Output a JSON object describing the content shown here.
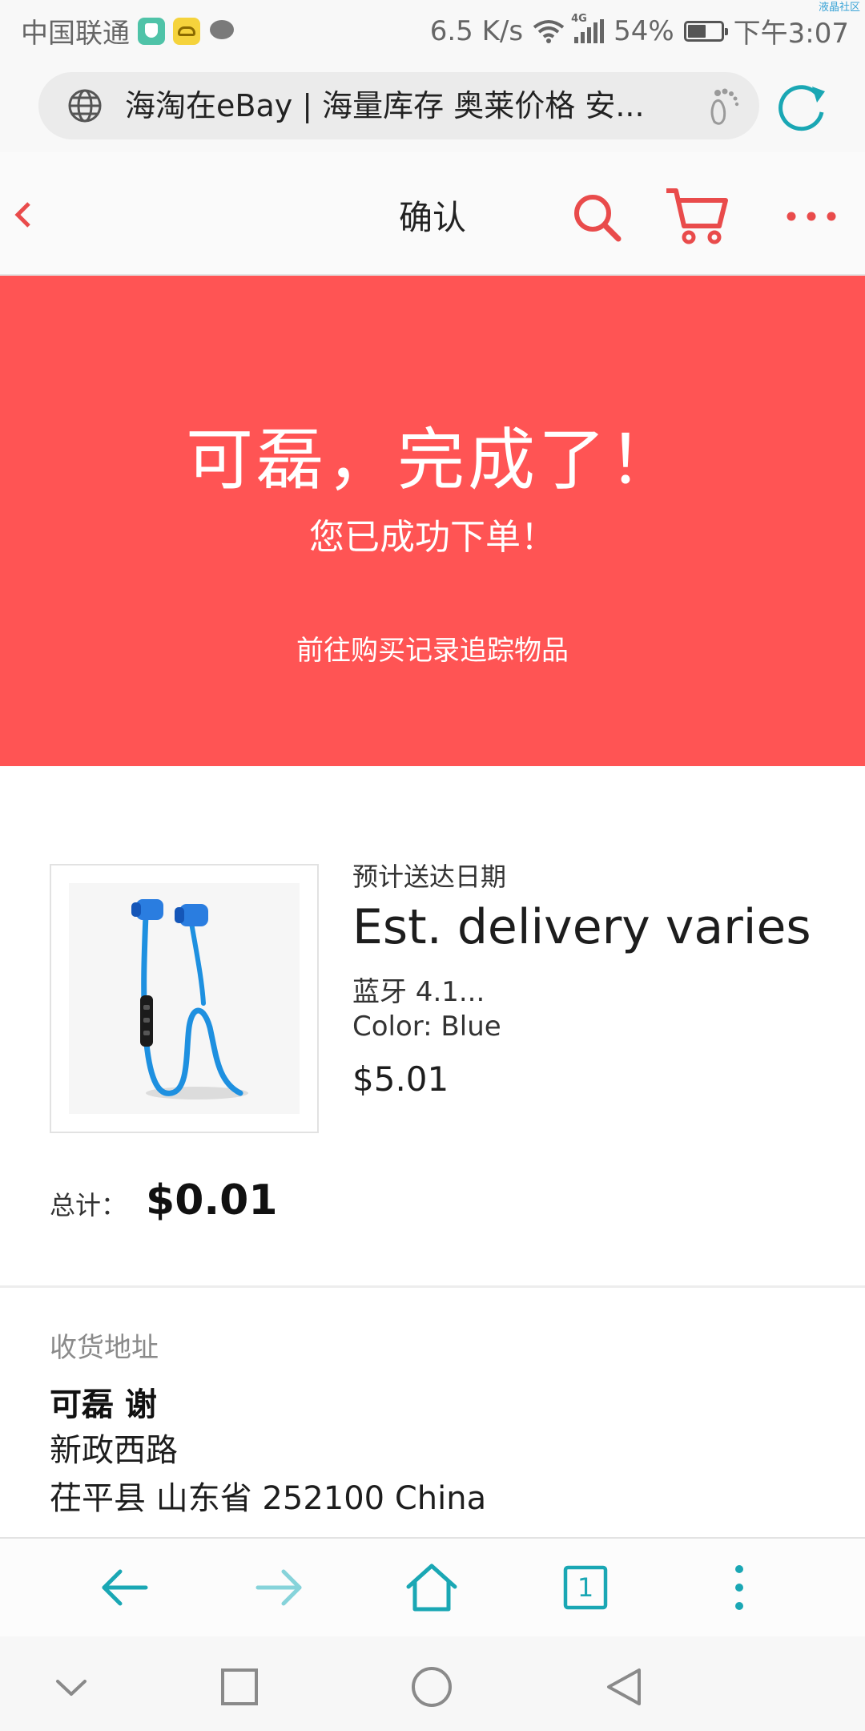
{
  "status_bar": {
    "carrier": "中国联通",
    "network_speed": "6.5 K/s",
    "network_type": "4G",
    "battery_percent": "54%",
    "battery_level": 0.54,
    "time": "下午3:07",
    "watermark": "液晶社区"
  },
  "browser": {
    "url_title": "海淘在eBay | 海量库存 奥莱价格 安...",
    "icons": [
      "globe-icon",
      "footprint-icon",
      "reload-icon"
    ],
    "accent": "#1aa7b4"
  },
  "header": {
    "title": "确认",
    "icons": [
      "back-icon",
      "search-icon",
      "cart-icon",
      "more-icon"
    ],
    "icon_color": "#e94b4b"
  },
  "banner": {
    "title": "可磊，完成了！",
    "subtitle": "您已成功下单！",
    "link": "前往购买记录追踪物品",
    "background": "#ff5454"
  },
  "order": {
    "delivery_label": "预计送达日期",
    "delivery_value": "Est. delivery varies",
    "item_name": "蓝牙 4.1...",
    "item_color": "Color: Blue",
    "item_price": "$5.01",
    "total_label": "总计：",
    "total_value": "$0.01"
  },
  "address": {
    "title": "收货地址",
    "name": "可磊 谢",
    "line1": "新政西路",
    "line2": "茌平县 山东省 252100 China"
  },
  "toolbar": {
    "tab_count": "1",
    "icons": [
      "back-arrow-icon",
      "forward-arrow-icon",
      "home-icon",
      "tabs-icon",
      "menu-dots-icon"
    ]
  },
  "system_nav": {
    "icons": [
      "collapse-icon",
      "recents-icon",
      "home-circle-icon",
      "back-triangle-icon"
    ]
  }
}
